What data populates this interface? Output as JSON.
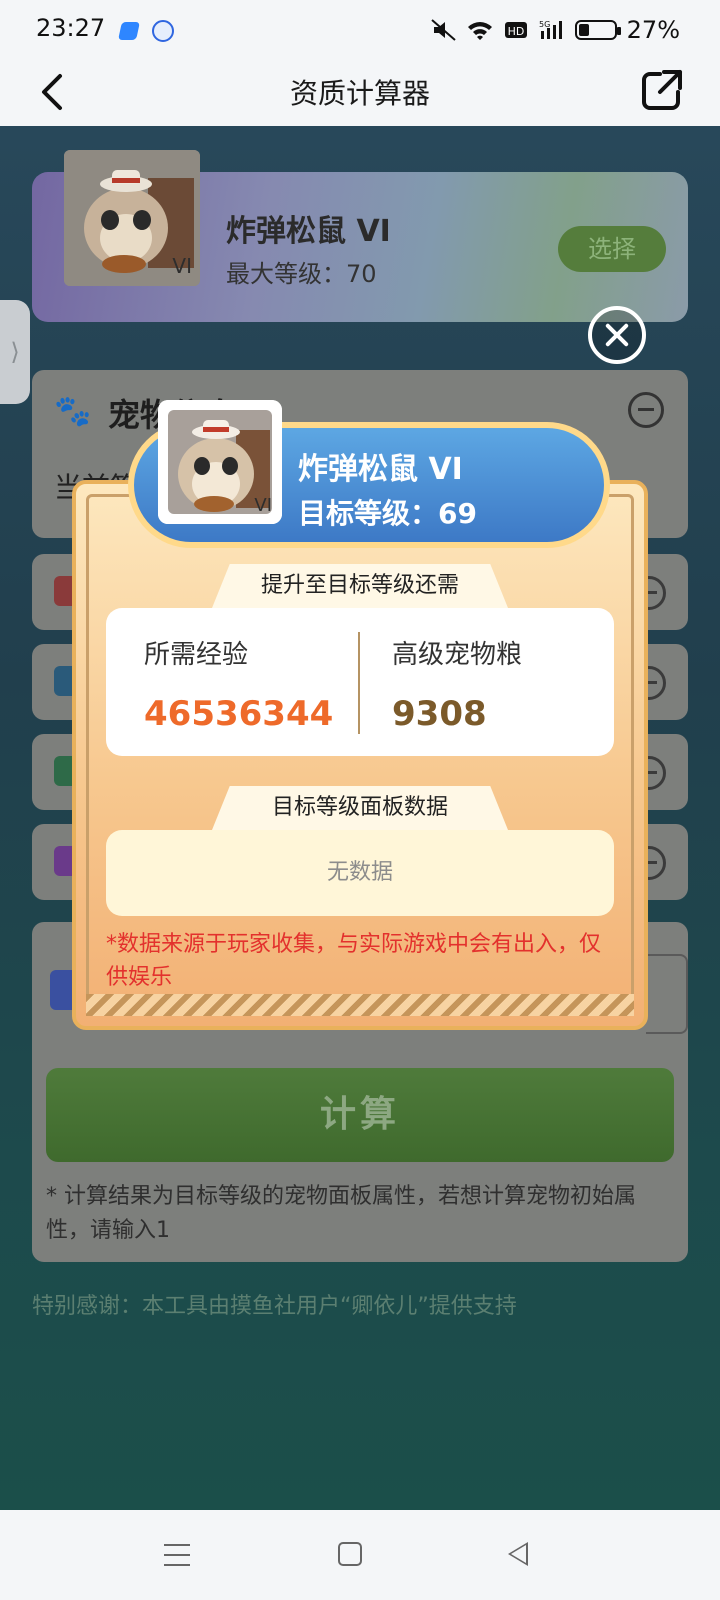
{
  "status_bar": {
    "time": "23:27",
    "battery": "27%",
    "icons": [
      "mute-icon",
      "wifi-icon",
      "hd-icon",
      "5g-signal-icon",
      "battery-icon"
    ]
  },
  "header": {
    "title": "资质计算器"
  },
  "pet_banner": {
    "name": "炸弹松鼠 VI",
    "max_level": "最大等级：70",
    "select_label": "选择",
    "rank_badge": "VI"
  },
  "pet_info": {
    "title": "宠物信息",
    "sub": "当前等"
  },
  "calc": {
    "button_label": "计算",
    "note": "* 计算结果为目标等级的宠物面板属性，若想计算宠物初始属性，请输入1"
  },
  "thanks": "特别感谢：本工具由摸鱼社用户“卿依儿”提供支持",
  "modal": {
    "pet_name": "炸弹松鼠 VI",
    "target_level": "目标等级：69",
    "rank_badge": "VI",
    "section1_title": "提升至目标等级还需",
    "exp_label": "所需经验",
    "exp_value": "46536344",
    "food_label": "高级宠物粮",
    "food_value": "9308",
    "section2_title": "目标等级面板数据",
    "no_data": "无数据",
    "disclaimer": "*数据来源于玩家收集，与实际游戏中会有出入，仅供娱乐"
  },
  "colors": {
    "exp_value": "#ee6a2a",
    "food_value": "#7b5a2a",
    "disclaimer": "#e3312d",
    "modal_head": "#4a8fd6"
  }
}
